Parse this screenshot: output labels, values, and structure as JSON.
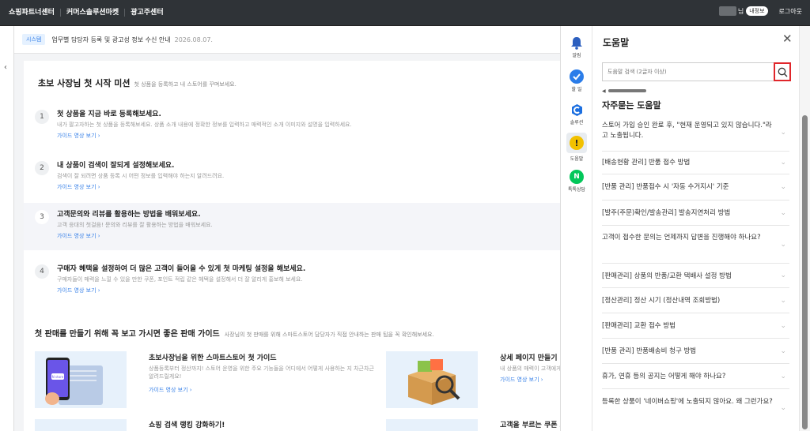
{
  "topbar": {
    "nav": [
      "쇼핑파트너센터",
      "커머스솔루션마켓",
      "광고주센터"
    ],
    "user_suffix": "님",
    "my_badge": "내정보",
    "logout": "로그아웃"
  },
  "notice": {
    "tag": "시스템",
    "message": "업무별 담당자 등록 및 광고성 정보 수신 안내",
    "date": "2026.08.07."
  },
  "missions": {
    "title": "초보 사장님 첫 시작 미션",
    "subtitle": "첫 상품을 등록하고 내 스토어를 꾸며보세요.",
    "items": [
      {
        "num": "1",
        "title": "첫 상품을 지금 바로 등록해보세요.",
        "desc": "내가 팔고자하는 첫 상품을 등록해보세요. 상품 소개 내용에 정확한 정보를 입력하고 매력적인 소개 이미지와 설명을 입력하세요.",
        "link": "가이드 영상 보기 ›"
      },
      {
        "num": "2",
        "title": "내 상품이 검색이 잘되게 설정해보세요.",
        "desc": "검색이 잘 되려면 상품 등록 시 어떤 정보를 입력해야 하는지 알려드려요.",
        "link": "가이드 영상 보기 ›"
      },
      {
        "num": "3",
        "title": "고객문의와 리뷰를 활용하는 방법을 배워보세요.",
        "desc": "고객 응대의 첫걸음! 문의와 리뷰를 잘 활용하는 방법을 배워보세요.",
        "link": "가이드 영상 보기 ›"
      },
      {
        "num": "4",
        "title": "구매자 혜택을 설정하여 더 많은 고객이 들어올 수 있게 첫 마케팅 설정을 해보세요.",
        "desc": "구매자들이 매력을 느낄 수 있을 만한 쿠폰, 포인트 적립 같은 혜택을 설정해서 더 잘 알리게 홍보해 보세요.",
        "link": "가이드 영상 보기 ›"
      }
    ]
  },
  "guides": {
    "title": "첫 판매를 만들기 위해 꼭 보고 가시면 좋은 판매 가이드",
    "subtitle": "사장님의 첫 판매를 위해 스마트스토어 담당자가 직접 안내하는 판매 팁을 꼭 확인해보세요.",
    "items": [
      {
        "title": "초보사장님을 위한 스마트스토어 첫 가이드",
        "desc": "상품등록부터 정산까지! 스토어 운영을 위한 주요 기능들을 어디에서 어떻게 사용하는 지 차근차근 알려드릴게요!",
        "link": "가이드 영상 보기 ›"
      },
      {
        "title": "상세 페이지 만들기 어렵지",
        "desc": "내 상품의 매력이 고객에게 잘 보이기",
        "link": "가이드 영상 보기 ›"
      },
      {
        "title": "쇼핑 검색 랭킹 강화하기!",
        "desc": "",
        "link": ""
      },
      {
        "title": "고객을 부르는 쿠폰 포인트",
        "desc": "",
        "link": ""
      }
    ],
    "card1_app_text": "N store"
  },
  "rail": [
    {
      "label": "알림",
      "icon": "bell-icon",
      "color": "#2c5fbf"
    },
    {
      "label": "할 일",
      "icon": "check-icon",
      "color": "#2b7de9"
    },
    {
      "label": "솔루션",
      "icon": "solution-icon",
      "color": "#1c6fe0"
    },
    {
      "label": "도움말",
      "icon": "help-icon",
      "color": "#f2c100"
    },
    {
      "label": "톡톡상담",
      "icon": "talk-icon",
      "color": "#03c75a"
    }
  ],
  "help": {
    "title": "도움말",
    "search_placeholder": "도움말 검색 (2글자 이상)",
    "faq_title": "자주묻는 도움말",
    "faqs": [
      "스토어 가입 승인 완료 후, \"현재 운영되고 있지 않습니다.\"라고 노출됩니다.",
      "[배송현황 관리] 반품 접수 방법",
      "[반품 관리] 반품접수 시 '자동 수거지시' 기준",
      "[발주(주문)확인/발송관리] 발송지연처리 방법",
      "고객이 접수한 문의는 언제까지 답변을 진행해야 하나요?",
      "[판매관리] 상품의 반품/교환 택배사 설정 방법",
      "[정산관리] 정산 시기 (정산내역 조회방법)",
      "[판매관리] 교환 접수 방법",
      "[반품 관리] 반품배송비 청구 방법",
      "휴가, 연휴 등의 공지는 어떻게 해야 하나요?",
      "등록한 상품이 '네이버쇼핑'에 노출되지 않아요. 왜 그런가요?"
    ]
  },
  "colors": {
    "topbar": "#2f3337",
    "link": "#3a82e8",
    "highlight": "#e0262b"
  }
}
